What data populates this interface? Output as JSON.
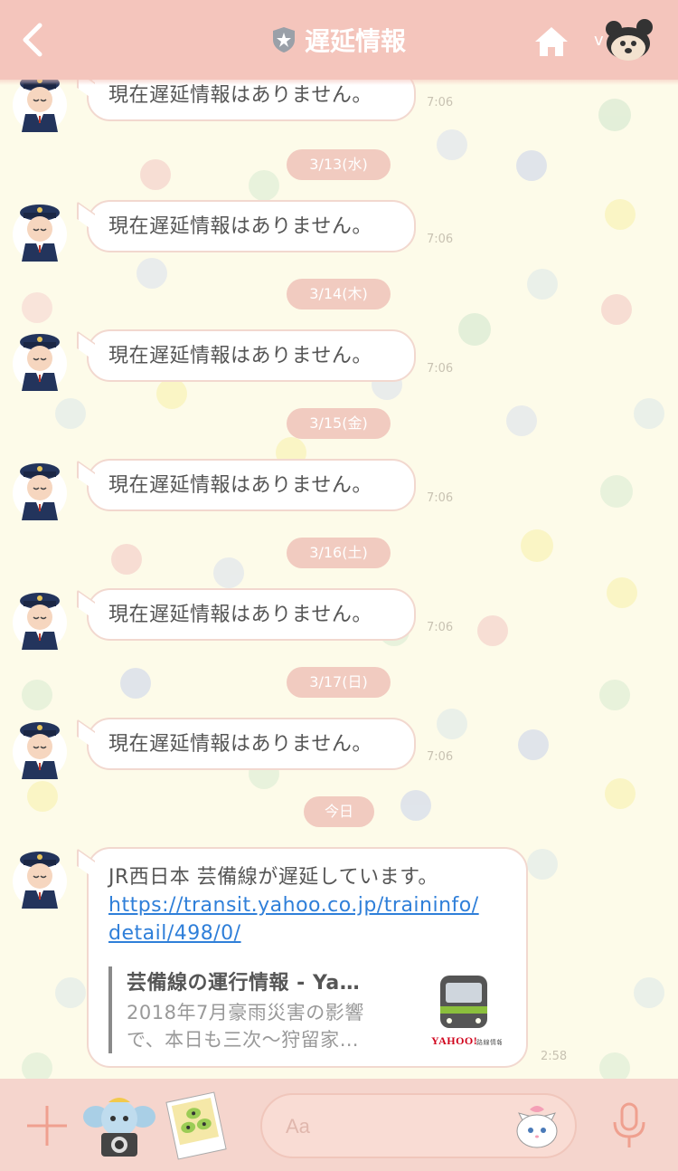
{
  "header": {
    "title": "遅延情報",
    "back_icon": "chevron-left-icon",
    "badge_icon": "shield-star-icon",
    "home_icon": "home-icon",
    "avatar_icon": "mickey-sticker-icon"
  },
  "messages": [
    {
      "text": "現在遅延情報はありません。",
      "time": "7:06"
    },
    {
      "date": "3/13(水)",
      "text": "現在遅延情報はありません。",
      "time": "7:06"
    },
    {
      "date": "3/14(木)",
      "text": "現在遅延情報はありません。",
      "time": "7:06"
    },
    {
      "date": "3/15(金)",
      "text": "現在遅延情報はありません。",
      "time": "7:06"
    },
    {
      "date": "3/16(土)",
      "text": "現在遅延情報はありません。",
      "time": "7:06"
    },
    {
      "date": "3/17(日)",
      "text": "現在遅延情報はありません。",
      "time": "7:06"
    }
  ],
  "today": {
    "date": "今日",
    "text": "JR西日本 芸備線が遅延しています。",
    "link_line1": "https://transit.yahoo.co.jp/traininfo/",
    "link_line2": "detail/498/0/",
    "preview_title": "芸備線の運行情報 - Ya…",
    "preview_desc_line1": "2018年7月豪雨災害の影響",
    "preview_desc_line2": "で、本日も三次～狩留家…",
    "preview_brand": "YAHOO!",
    "preview_brand_sub": "路線情報",
    "time": "2:58"
  },
  "footer": {
    "input_placeholder": "Aa",
    "plus_icon": "plus-icon",
    "mic_icon": "microphone-icon",
    "sticker_icons": [
      "dumbo-camera-sticker-icon",
      "aliens-photo-sticker-icon",
      "marie-cat-sticker-icon"
    ]
  },
  "colors": {
    "header_bg": "#f4c5bc",
    "chat_bg": "#fdfbe9",
    "date_chip": "#f1cbc0",
    "link": "#2f7fd9",
    "footer_bg": "#f5d5cd"
  }
}
